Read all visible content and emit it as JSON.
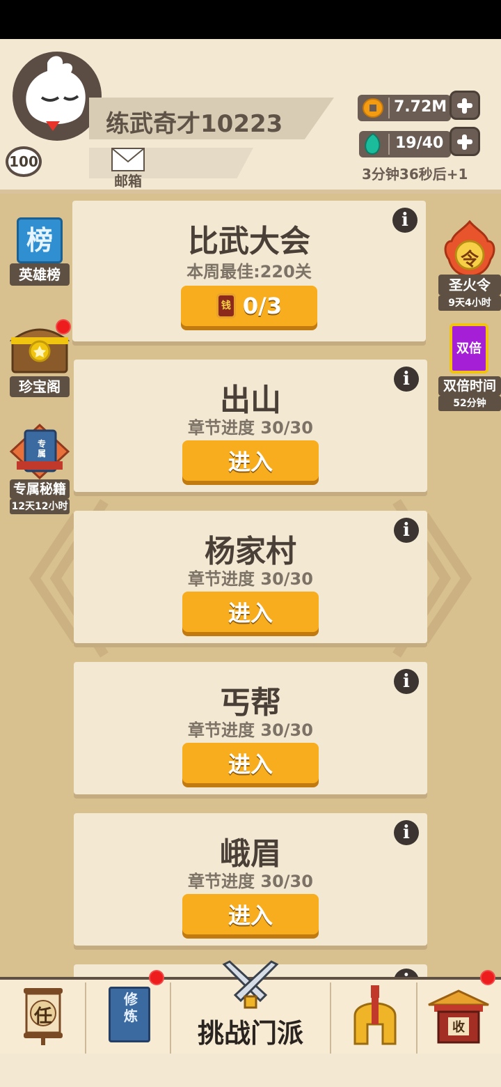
{
  "player": {
    "name": "练武奇才10223",
    "level": "100",
    "mail_label": "邮箱"
  },
  "currencies": {
    "coins": "7.72M",
    "gems": "19/40",
    "refill_timer": "3分钟36秒后+1"
  },
  "left_menu": {
    "hero_board": {
      "icon_text": "榜",
      "label": "英雄榜"
    },
    "treasure": {
      "label": "珍宝阁"
    },
    "secret_book": {
      "icon_text": "专属",
      "label": "专属秘籍",
      "time": "12天12小时"
    }
  },
  "right_menu": {
    "holy_fire": {
      "icon_text": "令",
      "label": "圣火令",
      "time": "9天4小时"
    },
    "double_time": {
      "icon_text": "双倍",
      "label": "双倍时间",
      "time": "52分钟"
    }
  },
  "tournament": {
    "title": "比武大会",
    "best": "本周最佳:220关",
    "tickets": "0/3",
    "ticket_icon_text": "钱"
  },
  "chapters": [
    {
      "title": "出山",
      "progress": "章节进度 30/30",
      "button": "进入"
    },
    {
      "title": "杨家村",
      "progress": "章节进度 30/30",
      "button": "进入"
    },
    {
      "title": "丐帮",
      "progress": "章节进度 30/30",
      "button": "进入"
    },
    {
      "title": "峨眉",
      "progress": "章节进度 30/30",
      "button": "进入"
    }
  ],
  "info_symbol": "i",
  "bottom_nav": {
    "task_icon_text": "任",
    "training_icon_text": "修炼",
    "challenge_label": "挑战门派",
    "collect_icon_text": "收"
  },
  "colors": {
    "accent_orange": "#f8ad1e",
    "background": "#d9c18f",
    "card": "#f3e8d2",
    "badge_red": "#ee1d1d"
  }
}
